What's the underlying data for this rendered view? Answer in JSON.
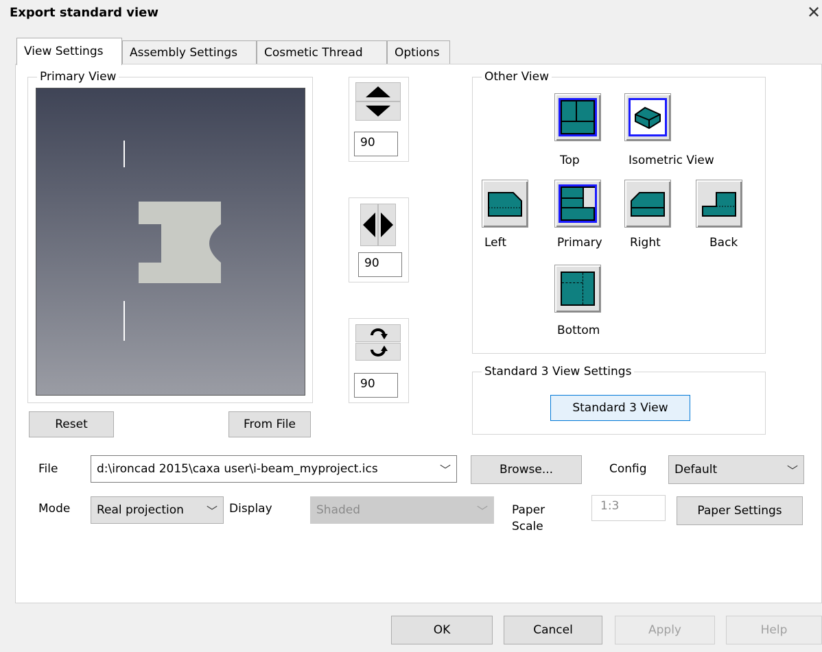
{
  "window": {
    "title": "Export standard view",
    "close_glyph": "✕"
  },
  "tabs": [
    {
      "label": "View Settings",
      "active": true
    },
    {
      "label": "Assembly Settings",
      "active": false
    },
    {
      "label": "Cosmetic Thread",
      "active": false
    },
    {
      "label": "Options",
      "active": false
    }
  ],
  "primary_view": {
    "legend": "Primary View",
    "reset_label": "Reset",
    "from_file_label": "From File"
  },
  "rotation": {
    "vertical_value": "90",
    "horizontal_value": "90",
    "spin_value": "90"
  },
  "other_view": {
    "legend": "Other View",
    "views": {
      "top": "Top",
      "isometric": "Isometric View",
      "left": "Left",
      "primary": "Primary",
      "right": "Right",
      "back": "Back",
      "bottom": "Bottom"
    }
  },
  "standard3": {
    "legend": "Standard 3 View Settings",
    "button_label": "Standard 3 View"
  },
  "file_row": {
    "file_label": "File",
    "file_value": "d:\\ironcad 2015\\caxa user\\i-beam_myproject.ics",
    "browse_label": "Browse...",
    "config_label": "Config",
    "config_value": "Default"
  },
  "mode_row": {
    "mode_label": "Mode",
    "mode_value": "Real projection",
    "display_label": "Display",
    "display_value": "Shaded",
    "paper_scale_line1": "Paper",
    "paper_scale_line2": "Scale",
    "paper_scale_value": "1:3",
    "paper_settings_label": "Paper Settings"
  },
  "footer": {
    "ok_label": "OK",
    "cancel_label": "Cancel",
    "apply_label": "Apply",
    "help_label": "Help"
  },
  "colors": {
    "selection_blue": "#1a1aff",
    "view_teal": "#0f8080",
    "viewport_top": "#3f4456",
    "viewport_bottom": "#9a9ca4",
    "part_gray": "#c8cac4"
  }
}
